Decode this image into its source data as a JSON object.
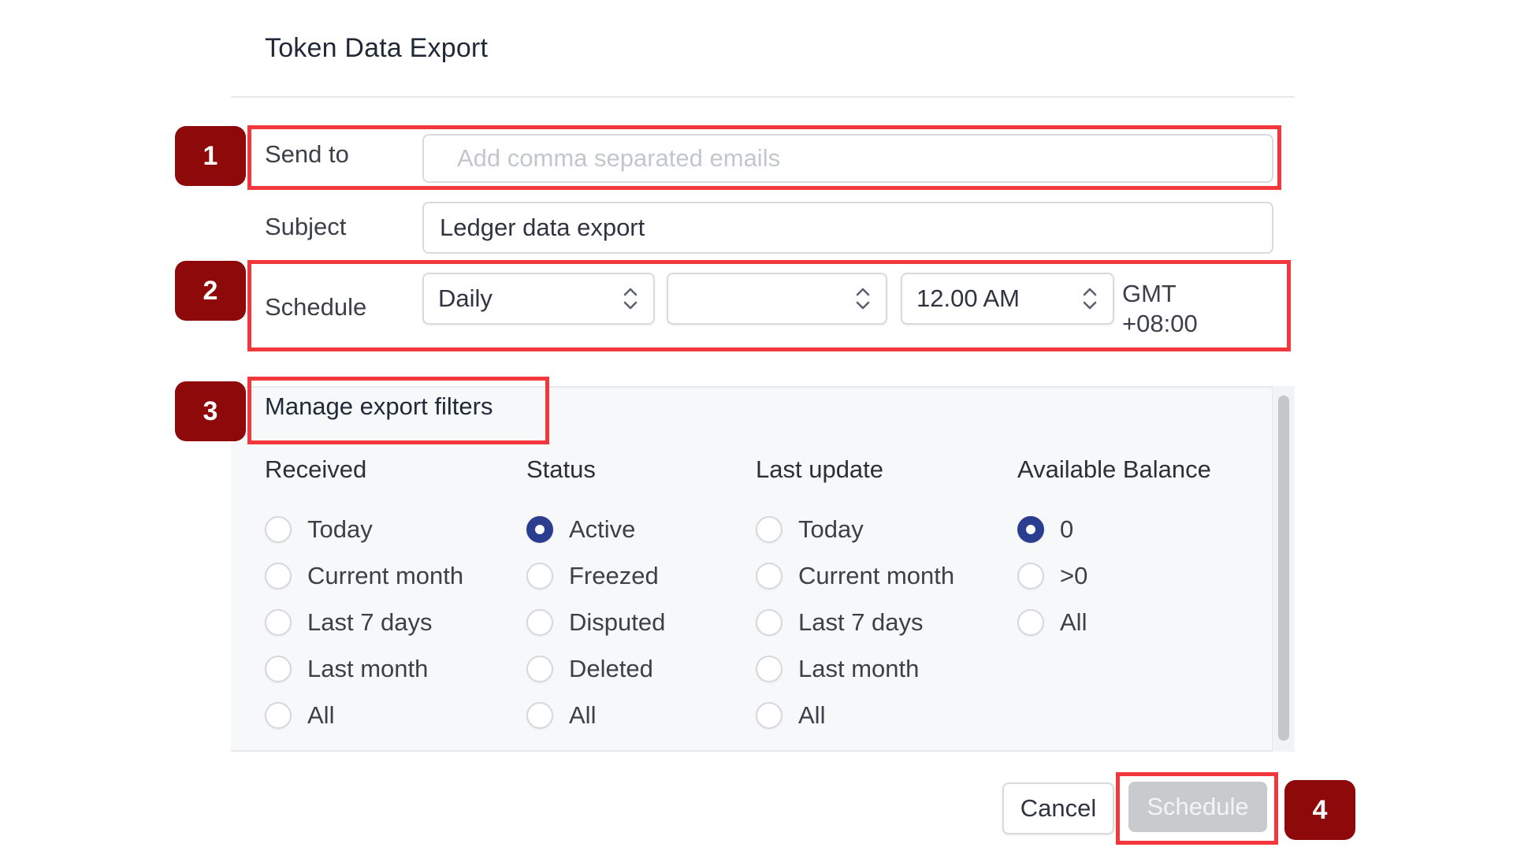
{
  "dialog": {
    "title": "Token Data Export"
  },
  "form": {
    "send_to": {
      "label": "Send to",
      "value": "",
      "placeholder": "Add comma separated emails"
    },
    "subject": {
      "label": "Subject",
      "value": "Ledger data export"
    },
    "schedule": {
      "label": "Schedule",
      "frequency": "Daily",
      "day": "",
      "time": "12.00 AM",
      "timezone_line1": "GMT",
      "timezone_line2": "+08:00"
    }
  },
  "filters": {
    "title": "Manage export filters",
    "columns": [
      {
        "heading": "Received",
        "options": [
          "Today",
          "Current month",
          "Last 7 days",
          "Last month",
          "All"
        ],
        "selected": null
      },
      {
        "heading": "Status",
        "options": [
          "Active",
          "Freezed",
          "Disputed",
          "Deleted",
          "All"
        ],
        "selected": "Active"
      },
      {
        "heading": "Last update",
        "options": [
          "Today",
          "Current month",
          "Last 7 days",
          "Last month",
          "All"
        ],
        "selected": null
      },
      {
        "heading": "Available Balance",
        "options": [
          "0",
          ">0",
          "All"
        ],
        "selected": "0"
      }
    ]
  },
  "actions": {
    "cancel_label": "Cancel",
    "schedule_label": "Schedule",
    "schedule_enabled": false
  },
  "annotations": {
    "badges": [
      "1",
      "2",
      "3",
      "4"
    ],
    "highlight_color": "#f2383c",
    "badge_color": "#8e0a0a"
  },
  "colors": {
    "radio_selected": "#2a3d8f",
    "panel_background": "#f7f8fa",
    "disabled_button": "#c9cacc"
  }
}
